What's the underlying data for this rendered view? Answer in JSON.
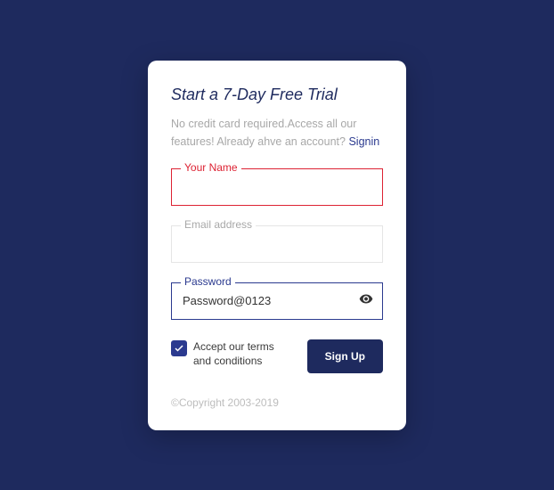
{
  "title": "Start a 7-Day Free Trial",
  "subtitle_part1": "No credit card required.Access all our features! Already ahve an account? ",
  "signin_label": "Signin",
  "fields": {
    "name": {
      "label": "Your Name",
      "value": ""
    },
    "email": {
      "label": "Email address",
      "value": ""
    },
    "password": {
      "label": "Password",
      "value": "Password@0123"
    }
  },
  "terms": {
    "label": "Accept our terms and conditions",
    "checked": true
  },
  "signup_button": "Sign Up",
  "copyright": "©Copyright 2003-2019"
}
